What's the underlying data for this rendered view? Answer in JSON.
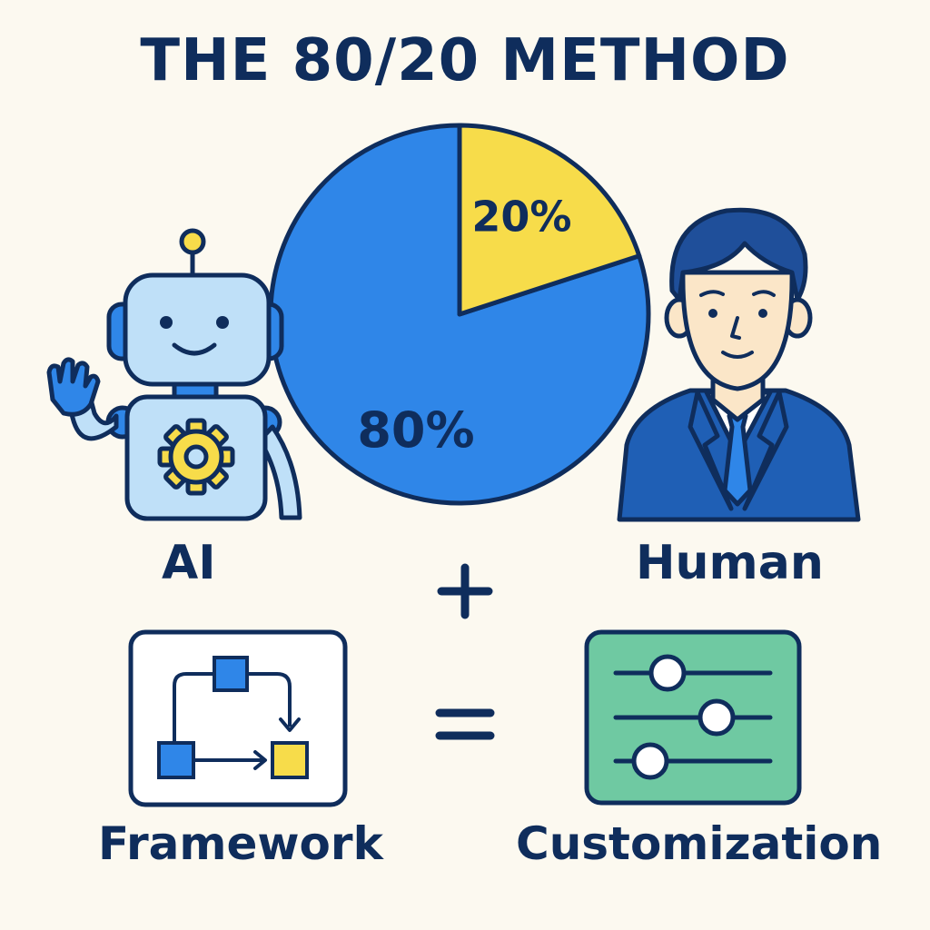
{
  "title": "THE 80/20 METHOD",
  "chart_data": {
    "type": "pie",
    "slices": [
      {
        "label": "80%",
        "value": 80,
        "color": "#2f86e8"
      },
      {
        "label": "20%",
        "value": 20,
        "color": "#f7dc4a"
      }
    ]
  },
  "left_figure": {
    "label": "AI",
    "icon": "robot-icon"
  },
  "right_figure": {
    "label": "Human",
    "icon": "businessman-icon"
  },
  "operators": {
    "plus": "+",
    "equals": "="
  },
  "bottom_left": {
    "label": "Framework",
    "icon": "flowchart-icon"
  },
  "bottom_right": {
    "label": "Customization",
    "icon": "sliders-icon"
  },
  "colors": {
    "navy": "#0f2d5c",
    "blue": "#2f86e8",
    "yellow": "#f7dc4a",
    "light_blue": "#bfe0f8",
    "green": "#6fc9a2",
    "background": "#fcf9f0"
  }
}
